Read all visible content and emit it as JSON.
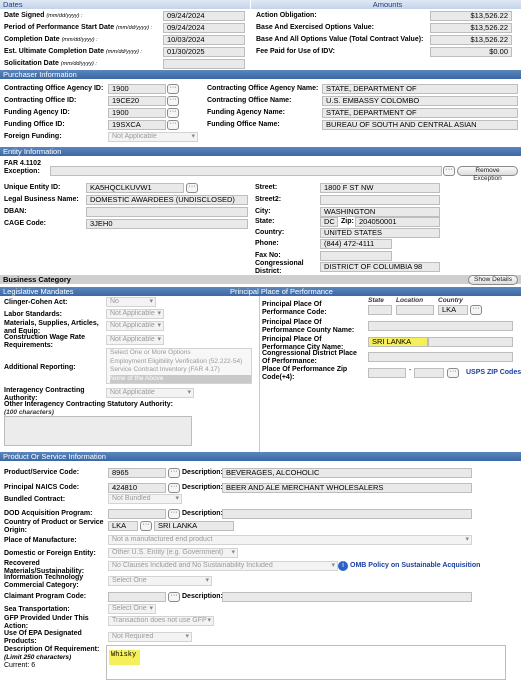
{
  "dates": {
    "header": "Dates",
    "date_signed_label": "Date Signed",
    "date_signed": "09/24/2024",
    "pop_start_label": "Period of Performance Start Date",
    "pop_start": "09/24/2024",
    "completion_label": "Completion Date",
    "completion": "10/03/2024",
    "est_ult_label": "Est. Ultimate Completion Date",
    "est_ult": "01/30/2025",
    "solicitation_label": "Solicitation Date",
    "solicitation": "",
    "date_fmt": "(mm/dd/yyyy) :"
  },
  "amounts": {
    "header": "Amounts",
    "action_obligation_label": "Action Obligation:",
    "action_obligation": "$13,526.22",
    "base_exercised_label": "Base And Exercised Options Value:",
    "base_exercised": "$13,526.22",
    "base_all_label": "Base And All Options Value (Total Contract Value):",
    "base_all": "$13,526.22",
    "fee_idv_label": "Fee Paid for Use of IDV:",
    "fee_idv": "$0.00"
  },
  "purchaser": {
    "header": "Purchaser Information",
    "co_agency_id_label": "Contracting Office Agency ID:",
    "co_agency_id": "1900",
    "co_agency_name_label": "Contracting Office Agency Name:",
    "co_agency_name": "STATE, DEPARTMENT OF",
    "co_id_label": "Contracting Office ID:",
    "co_id": "19CE20",
    "co_name_label": "Contracting Office Name:",
    "co_name": "U.S. EMBASSY COLOMBO",
    "funding_agency_id_label": "Funding Agency ID:",
    "funding_agency_id": "1900",
    "funding_agency_name_label": "Funding Agency Name:",
    "funding_agency_name": "STATE, DEPARTMENT OF",
    "funding_office_id_label": "Funding Office ID:",
    "funding_office_id": "19SXCA",
    "funding_office_name_label": "Funding Office Name:",
    "funding_office_name": "BUREAU OF SOUTH AND CENTRAL ASIAN",
    "foreign_funding_label": "Foreign Funding:",
    "foreign_funding": "Not Applicable"
  },
  "entity": {
    "header": "Entity Information",
    "far_label": "FAR 4.1102",
    "exception_label": "Exception:",
    "remove_exception": "Remove Exception",
    "uei_label": "Unique Entity ID:",
    "uei": "KA5HQCLKUVW1",
    "legal_name_label": "Legal Business Name:",
    "legal_name": "DOMESTIC AWARDEES (UNDISCLOSED)",
    "dban_label": "DBAN:",
    "dban": "",
    "cage_label": "CAGE Code:",
    "cage": "3JEH0",
    "street_label": "Street:",
    "street": "1800 F ST NW",
    "street2_label": "Street2:",
    "street2": "",
    "city_label": "City:",
    "city": "WASHINGTON",
    "state_label": "State:",
    "state": "DC",
    "zip_label": "Zip:",
    "zip": "204050001",
    "country_label": "Country:",
    "country": "UNITED STATES",
    "phone_label": "Phone:",
    "phone": "(844) 472-4111",
    "fax_label": "Fax No:",
    "fax": "",
    "cong_label": "Congressional District:",
    "cong": "DISTRICT OF COLUMBIA 98",
    "business_category_label": "Business Category",
    "show_details": "Show Details"
  },
  "legislative": {
    "header": "Legislative Mandates",
    "clinger_label": "Clinger-Cohen Act:",
    "clinger": "No",
    "labor_label": "Labor Standards:",
    "labor": "Not Applicable",
    "materials_label": "Materials, Supplies, Articles, and Equip:",
    "materials": "Not Applicable",
    "construction_label": "Construction Wage Rate Requirements:",
    "construction": "Not Applicable",
    "additional_label": "Additional Reporting:",
    "additional_options": [
      "Select One or More Options",
      "Employment Eligibility Verification (52.222-54)",
      "Service Contract Inventory (FAR 4.17)",
      "None of the Above"
    ],
    "interagency_label": "Interagency Contracting Authority:",
    "interagency": "Not Applicable",
    "other_ica_label": "Other Interagency Contracting Statutory Authority:",
    "other_ica_note": "(100 characters)"
  },
  "place": {
    "header": "Principal Place of Performance",
    "code_label": "Principal Place Of Performance Code:",
    "state_col": "State",
    "location_col": "Location",
    "country_col": "Country",
    "country_code": "LKA",
    "county_label": "Principal Place Of Performance County Name:",
    "city_label": "Principal Place Of Performance City Name:",
    "city": "SRI LANKA",
    "cong_label": "Congressional District Place Of Performance:",
    "zip_label": "Place Of Performance Zip Code(+4):",
    "zip_dash": "-",
    "usps_label": "USPS ZIP Codes"
  },
  "product": {
    "header": "Product Or Service Information",
    "psc_label": "Product/Service Code:",
    "psc": "8965",
    "desc_label": "Description:",
    "psc_desc": "BEVERAGES, ALCOHOLIC",
    "naics_label": "Principal NAICS Code:",
    "naics": "424810",
    "naics_desc": "BEER AND ALE MERCHANT WHOLESALERS",
    "bundled_label": "Bundled Contract:",
    "bundled": "Not Bundled",
    "dod_label": "DOD Acquisition Program:",
    "country_prod_label": "Country of Product or Service Origin:",
    "country_prod_code": "LKA",
    "country_prod_name": "SRI LANKA",
    "manufacture_label": "Place of Manufacture:",
    "manufacture": "Not a manufactured end product",
    "domestic_label": "Domestic or Foreign Entity:",
    "domestic": "Other U.S. Entity (e.g. Government)",
    "recovered_label": "Recovered Materials/Sustainability:",
    "recovered": "No Clauses Included and No Sustainability Included",
    "omb_label": "OMB Policy on Sustainable Acquisition",
    "it_label": "Information Technology Commercial Category:",
    "it": "Select One",
    "claimant_label": "Claimant Program Code:",
    "sea_label": "Sea Transportation:",
    "sea": "Select One",
    "gfp_label": "GFP Provided Under This Action:",
    "gfp": "Transaction does not use GFP",
    "epa_label": "Use Of EPA Designated Products:",
    "epa": "Not Required",
    "desc_req_label": "Description Of Requirement:",
    "desc_req_limit": "(Limit 250 characters)",
    "desc_req_current": "Current: 6",
    "desc_req": "Whisky"
  }
}
